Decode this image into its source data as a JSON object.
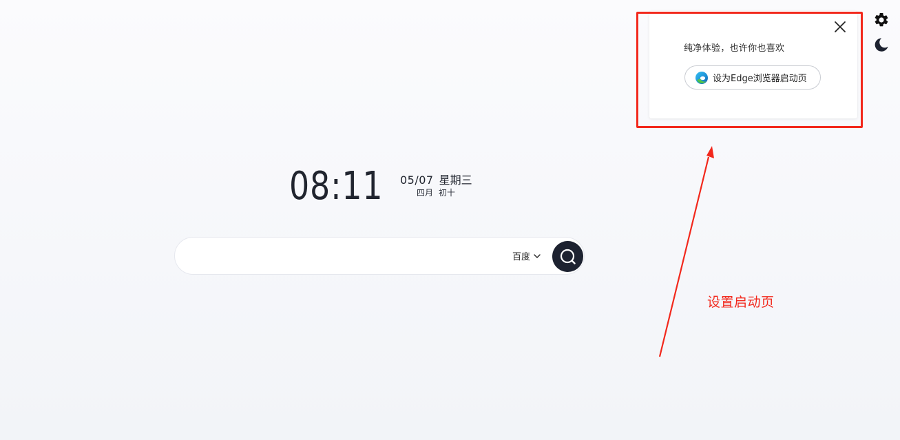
{
  "clock": {
    "time": "08:11",
    "date": "05/07",
    "weekday": "星期三",
    "lunar_month": "四月",
    "lunar_day": "初十"
  },
  "search": {
    "value": "",
    "placeholder": "",
    "engine": "百度"
  },
  "popup": {
    "message": "纯净体验，也许你也喜欢",
    "button_label": "设为Edge浏览器启动页"
  },
  "annotation": {
    "label": "设置启动页",
    "color": "#f2281c"
  },
  "icons": {
    "settings": "gear-icon",
    "theme": "moon-icon",
    "close": "close-icon",
    "edge": "edge-logo-icon",
    "engine_dropdown": "chevron-down-icon",
    "search": "search-icon"
  },
  "colors": {
    "background": "#f7f8fb",
    "dark": "#1d2230"
  }
}
